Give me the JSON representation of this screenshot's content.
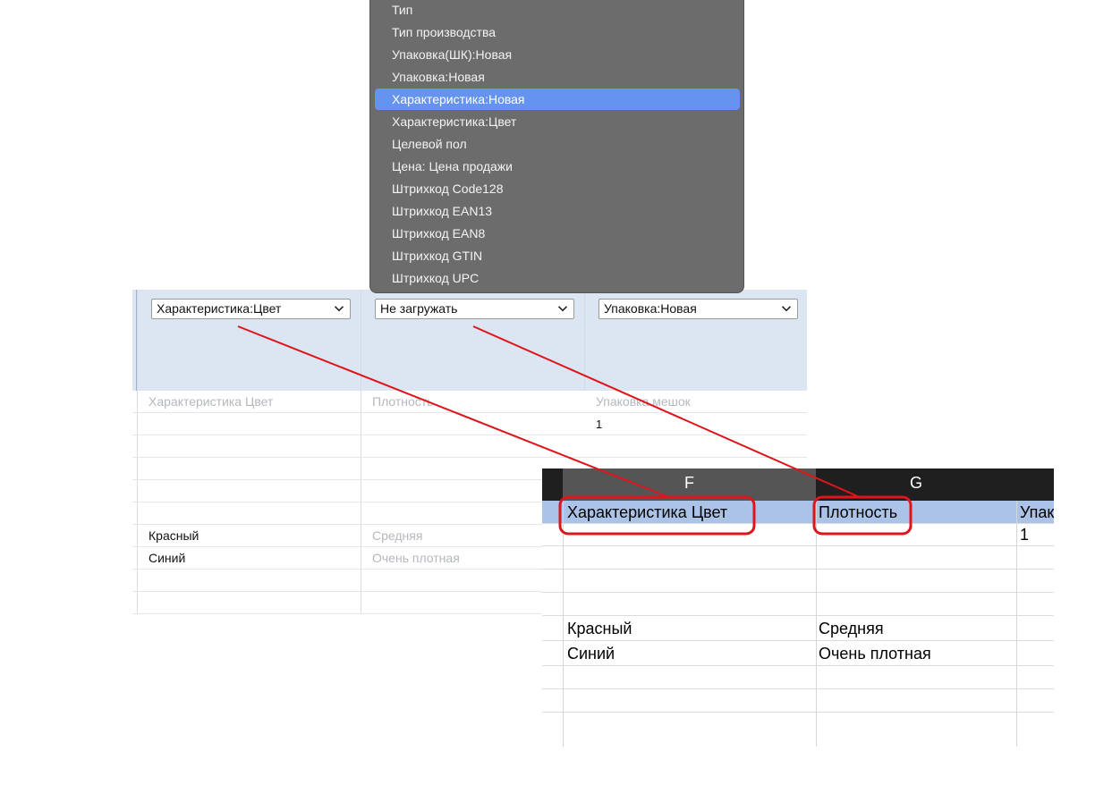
{
  "dropdown": {
    "items": [
      {
        "label": "Тип",
        "selected": false
      },
      {
        "label": "Тип производства",
        "selected": false
      },
      {
        "label": "Упаковка(ШК):Новая",
        "selected": false
      },
      {
        "label": "Упаковка:Новая",
        "selected": false
      },
      {
        "label": "Характеристика:Новая",
        "selected": true
      },
      {
        "label": "Характеристика:Цвет",
        "selected": false
      },
      {
        "label": "Целевой пол",
        "selected": false
      },
      {
        "label": "Цена: Цена продажи",
        "selected": false
      },
      {
        "label": "Штрихкод Code128",
        "selected": false
      },
      {
        "label": "Штрихкод EAN13",
        "selected": false
      },
      {
        "label": "Штрихкод EAN8",
        "selected": false
      },
      {
        "label": "Штрихкод GTIN",
        "selected": false
      },
      {
        "label": "Штрихкод UPC",
        "selected": false
      }
    ]
  },
  "mapping": {
    "selects": [
      {
        "value": "Характеристика:Цвет"
      },
      {
        "value": "Не загружать"
      },
      {
        "value": "Упаковка:Новая"
      }
    ],
    "rows": [
      {
        "c1": "Характеристика Цвет",
        "c2": "Плотность",
        "c3": "Упаковка мешок",
        "style": "muted"
      },
      {
        "c1": "",
        "c2": "",
        "c3": "1",
        "style": "dark"
      },
      {
        "c1": "",
        "c2": "",
        "c3": "",
        "style": "dark"
      },
      {
        "c1": "",
        "c2": "",
        "c3": "",
        "style": "dark"
      },
      {
        "c1": "",
        "c2": "",
        "c3": "",
        "style": "dark"
      },
      {
        "c1": "",
        "c2": "",
        "c3": "",
        "style": "dark"
      },
      {
        "c1": "Красный",
        "c2": "Средняя",
        "c3": "",
        "style": "mixed"
      },
      {
        "c1": "Синий",
        "c2": "Очень плотная",
        "c3": "",
        "style": "mixed"
      },
      {
        "c1": "",
        "c2": "",
        "c3": "",
        "style": "dark"
      },
      {
        "c1": "",
        "c2": "",
        "c3": "",
        "style": "dark"
      }
    ]
  },
  "sheet": {
    "col_headers": [
      "F",
      "G"
    ],
    "rows": [
      {
        "f": "Характеристика Цвет",
        "g": "Плотность",
        "h": "Упак"
      },
      {
        "f": "",
        "g": "",
        "h": "1"
      },
      {
        "f": "",
        "g": "",
        "h": ""
      },
      {
        "f": "",
        "g": "",
        "h": ""
      },
      {
        "f": "",
        "g": "",
        "h": ""
      },
      {
        "f": "Красный",
        "g": "Средняя",
        "h": ""
      },
      {
        "f": "Синий",
        "g": "Очень плотная",
        "h": ""
      },
      {
        "f": "",
        "g": "",
        "h": ""
      },
      {
        "f": "",
        "g": "",
        "h": ""
      }
    ]
  },
  "colors": {
    "dropdown_bg": "#6c6c6c",
    "dropdown_selected": "#6494f0",
    "header_band": "#dce6f2",
    "sheet_header": "#1f1f1f",
    "sheet_first_row": "#aac3e6",
    "annotation": "#e0141b"
  },
  "icons": {
    "select_chevron": "chevron-down-icon"
  }
}
